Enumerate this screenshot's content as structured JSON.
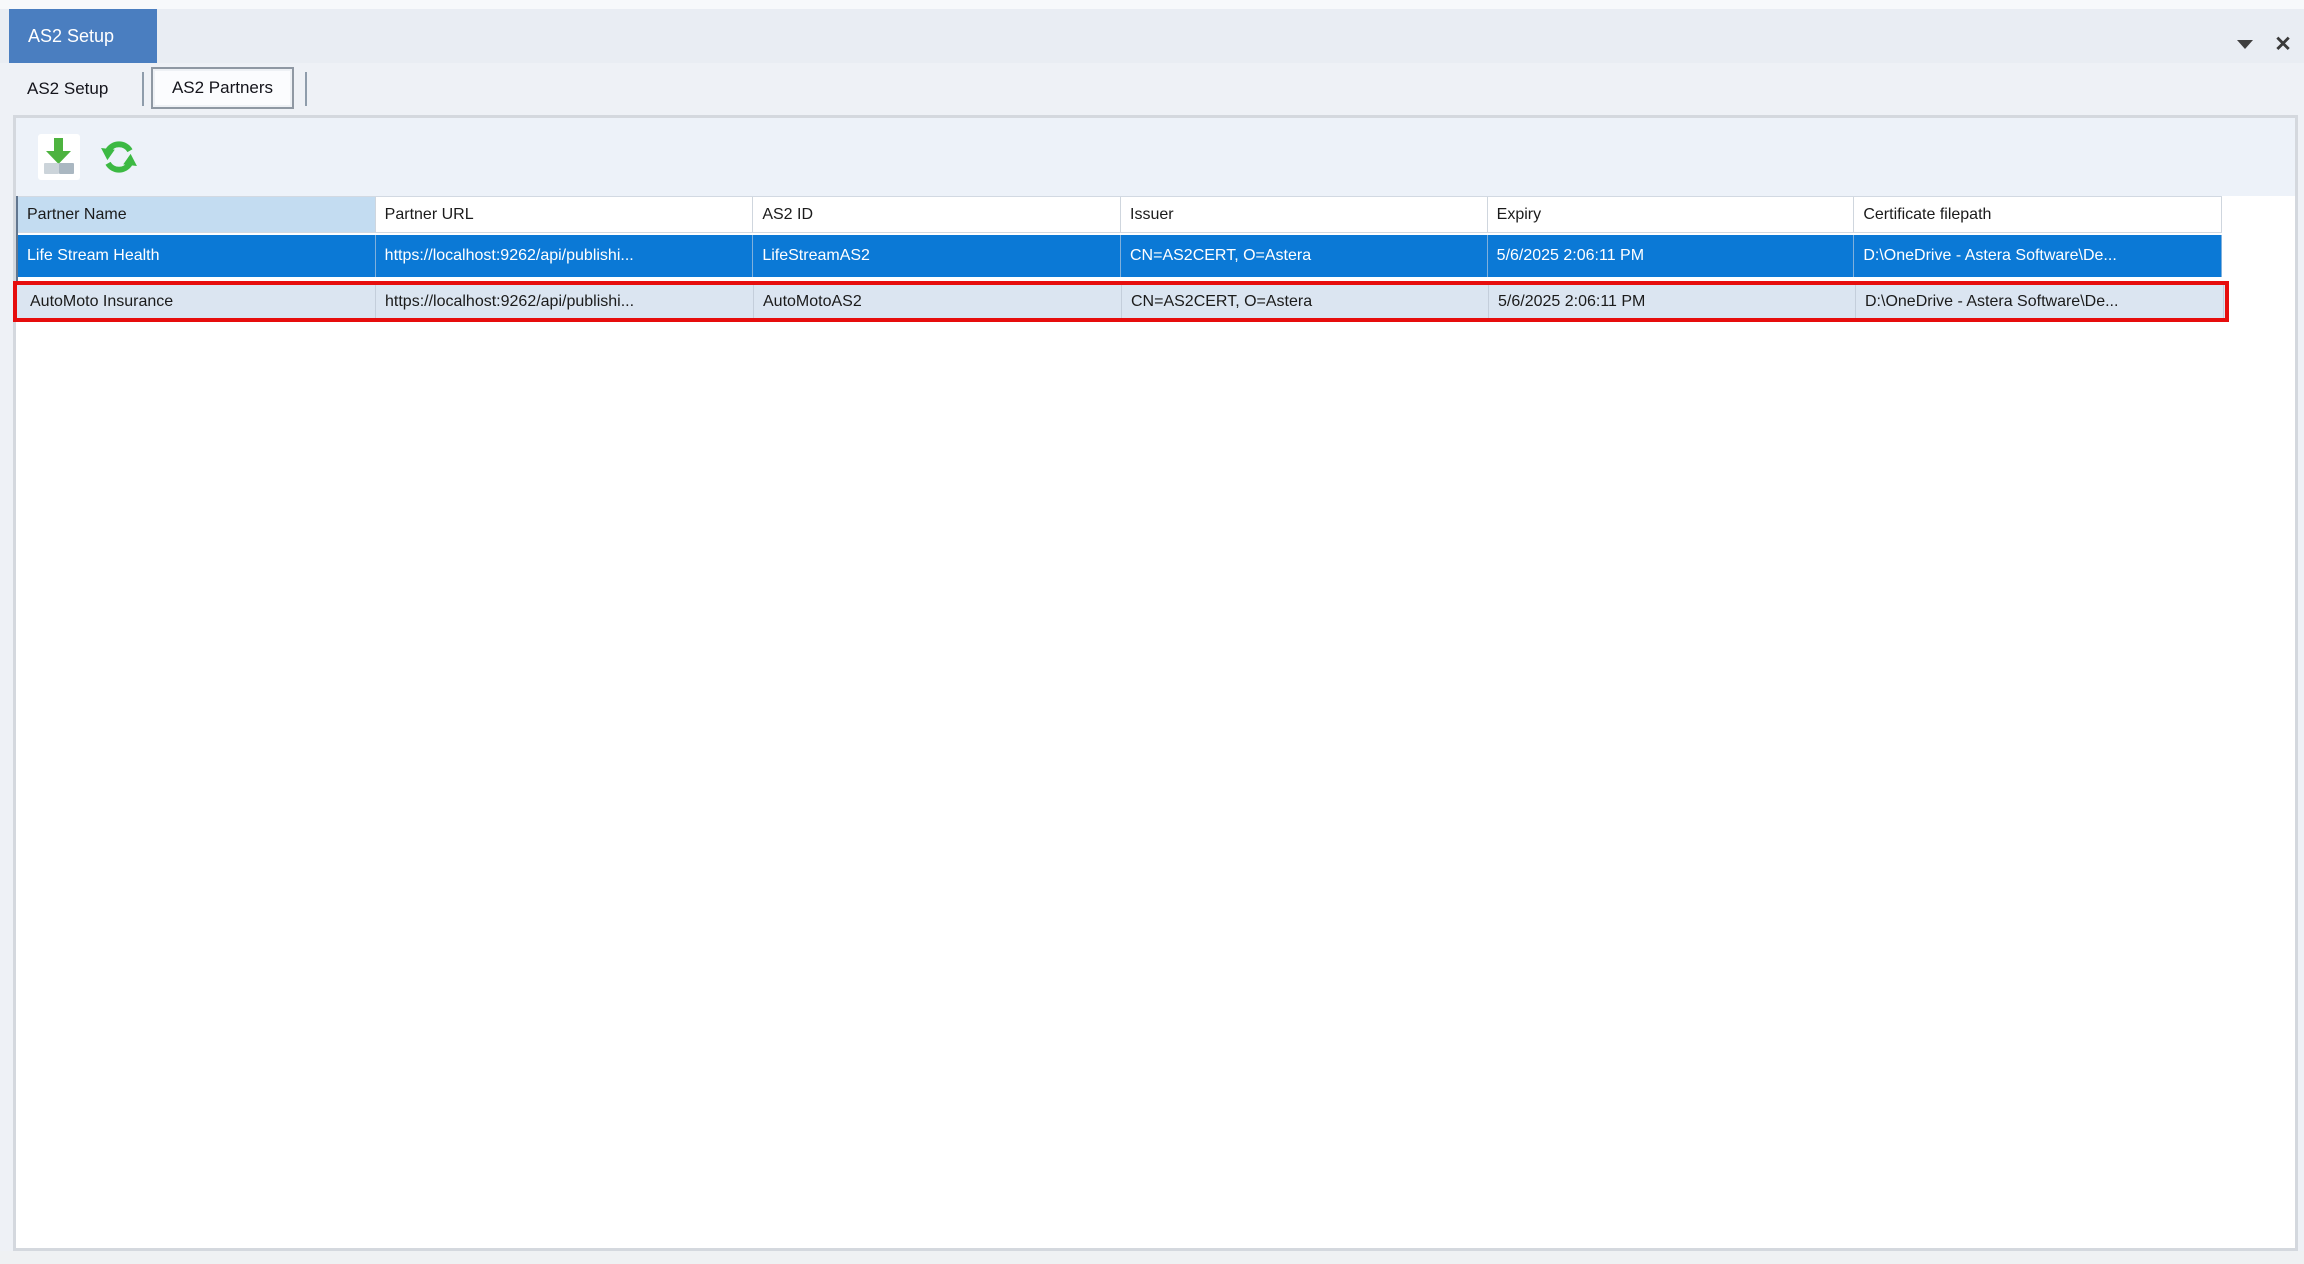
{
  "window": {
    "title_tab": "AS2 Setup",
    "controls": [
      {
        "icon": "chevron-down-icon"
      },
      {
        "icon": "close-icon",
        "glyph": "✕"
      }
    ]
  },
  "tabs": [
    {
      "label": "AS2 Setup",
      "selected": false
    },
    {
      "label": "AS2 Partners",
      "selected": true
    }
  ],
  "toolbar": {
    "buttons": [
      {
        "name": "import-partner",
        "icon": "import-download-icon"
      },
      {
        "name": "refresh",
        "icon": "refresh-icon"
      }
    ]
  },
  "colors": {
    "doc_tab_blue": "#4a7ec0",
    "selected_row_blue": "#0b79d6",
    "selected_column_header": "#c3dcf1",
    "highlight_annotation_red": "#e60d0d",
    "highlighted_row_bg": "#dbe5f1",
    "toolbar_icon_green": "#3cb943"
  },
  "table": {
    "columns": [
      "Partner Name",
      "Partner URL",
      "AS2 ID",
      "Issuer",
      "Expiry",
      "Certificate filepath"
    ],
    "rows": [
      {
        "state": "selected",
        "cells": [
          "Life Stream Health",
          "https://localhost:9262/api/publishi...",
          "LifeStreamAS2",
          "CN=AS2CERT, O=Astera",
          "5/6/2025 2:06:11 PM",
          "D:\\OneDrive - Astera Software\\De..."
        ]
      },
      {
        "state": "highlighted-red-box",
        "cells": [
          "AutoMoto Insurance",
          "https://localhost:9262/api/publishi...",
          "AutoMotoAS2",
          "CN=AS2CERT, O=Astera",
          "5/6/2025 2:06:11 PM",
          "D:\\OneDrive - Astera Software\\De..."
        ]
      }
    ]
  }
}
